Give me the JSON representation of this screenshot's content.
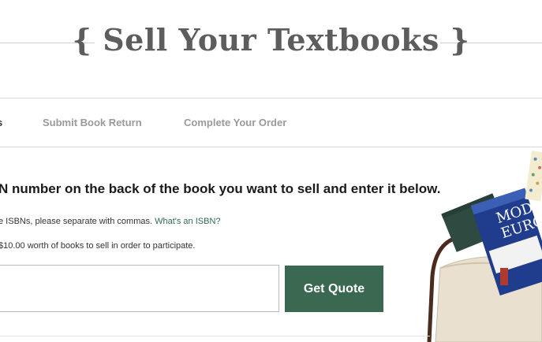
{
  "hero": {
    "title": "{ Sell Your Textbooks }"
  },
  "steps": [
    {
      "label": "s"
    },
    {
      "label": "Submit Book Return"
    },
    {
      "label": "Complete Your Order"
    }
  ],
  "main": {
    "headline": "N number on the back of the book you want to sell and enter it below.",
    "note_multiple": "e ISBNs, please separate with commas.",
    "isbn_link": "What's an ISBN?",
    "note_minimum": "$10.00 worth of books to sell in order to participate.",
    "isbn_input_value": "",
    "get_quote_label": "Get Quote"
  },
  "illustration": {
    "book_cover_lines": [
      "MODE",
      "EURO"
    ]
  },
  "colors": {
    "accent": "#3b6850",
    "link": "#2f6b51",
    "title": "#5d5d5d",
    "step_inactive": "#9a9a9a"
  },
  "icons": {
    "illustration": "book-bag-illustration"
  }
}
